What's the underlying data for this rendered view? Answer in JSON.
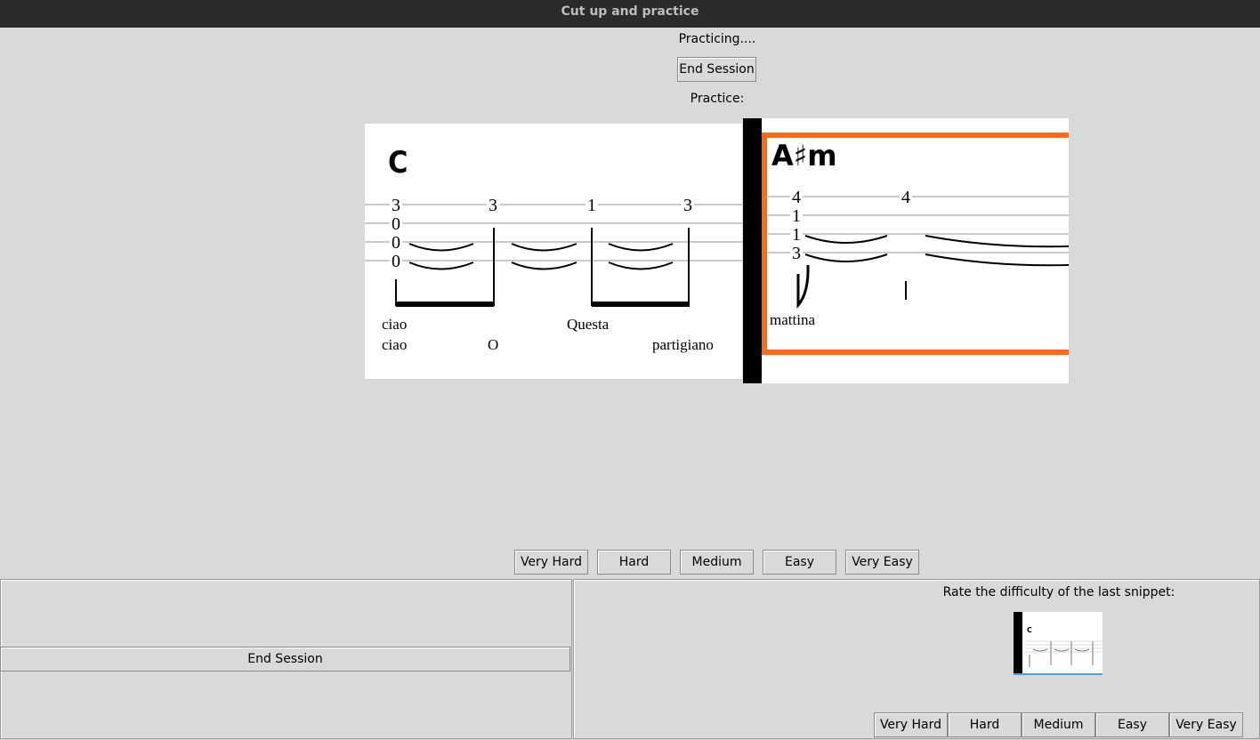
{
  "window": {
    "title": "Cut up and practice"
  },
  "status": "Practicing....",
  "top_end_session": "End Session",
  "practice_label": "Practice:",
  "snippet1": {
    "chord": "C",
    "frets": [
      "3",
      "0",
      "0",
      "0",
      "3",
      "1",
      "3"
    ],
    "lyrics": [
      "ciao",
      "ciao",
      "O",
      "Questa",
      "partigiano"
    ]
  },
  "snippet2": {
    "chord": "A♯m",
    "frets": [
      "4",
      "1",
      "1",
      "3",
      "4"
    ],
    "lyrics": [
      "mattina"
    ],
    "highlight_color": "#f26d21"
  },
  "rating_buttons": [
    "Very Hard",
    "Hard",
    "Medium",
    "Easy",
    "Very Easy"
  ],
  "bottom": {
    "left_end_session": "End Session",
    "rate_label": "Rate the difficulty of the last snippet:",
    "thumbnail_chord": "C",
    "rating_buttons": [
      "Very Hard",
      "Hard",
      "Medium",
      "Easy",
      "Very Easy"
    ]
  }
}
